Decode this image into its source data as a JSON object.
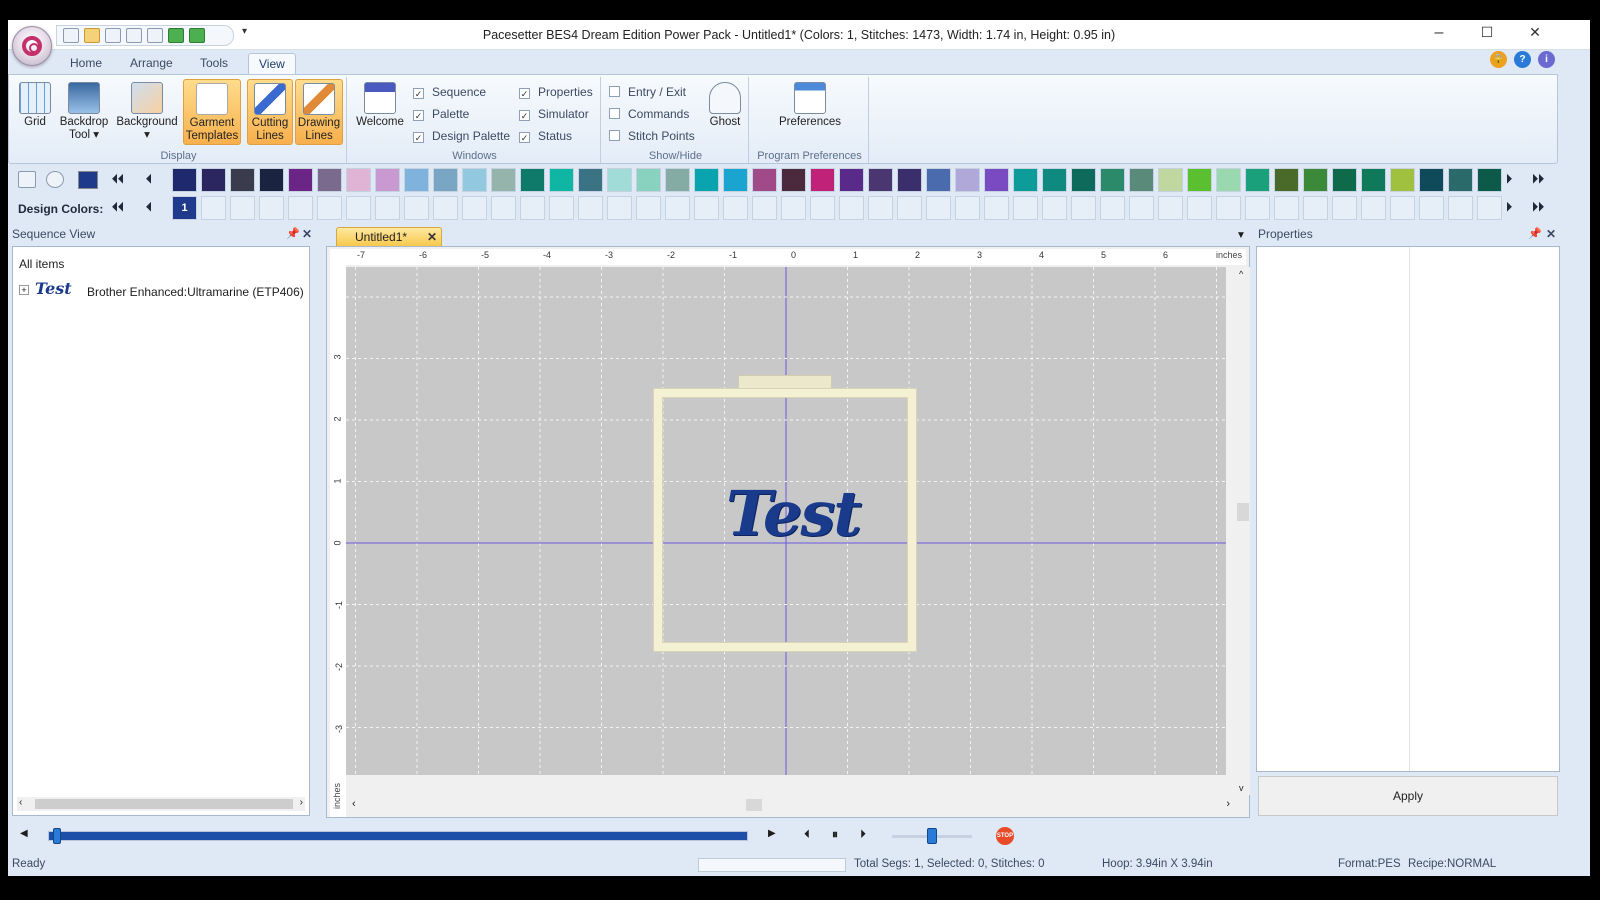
{
  "title": "Pacesetter BES4 Dream Edition Power Pack - Untitled1* (Colors: 1, Stitches: 1473, Width: 1.74 in, Height: 0.95 in)",
  "window_controls": {
    "minimize": "–",
    "maximize": "☐",
    "close": "✕"
  },
  "menu_tabs": [
    "Home",
    "Arrange",
    "Tools",
    "View"
  ],
  "active_tab": "View",
  "ribbon": {
    "display": {
      "label": "Display",
      "buttons": [
        {
          "label1": "Grid",
          "label2": "",
          "icon": "grid-icon"
        },
        {
          "label1": "Backdrop",
          "label2": "Tool ▾",
          "icon": "monitor-icon"
        },
        {
          "label1": "Background",
          "label2": "▾",
          "icon": "background-icon"
        },
        {
          "label1": "Garment",
          "label2": "Templates",
          "icon": "shirt-icon"
        },
        {
          "label1": "Cutting",
          "label2": "Lines",
          "icon": "knife-icon"
        },
        {
          "label1": "Drawing",
          "label2": "Lines",
          "icon": "pen-icon"
        }
      ]
    },
    "windows": {
      "label": "Windows",
      "welcome": "Welcome",
      "col1": [
        {
          "label": "Sequence",
          "checked": true
        },
        {
          "label": "Palette",
          "checked": true
        },
        {
          "label": "Design Palette",
          "checked": true
        }
      ],
      "col2": [
        {
          "label": "Properties",
          "checked": true
        },
        {
          "label": "Simulator",
          "checked": true
        },
        {
          "label": "Status",
          "checked": true
        }
      ]
    },
    "showhide": {
      "label": "Show/Hide",
      "items": [
        {
          "label": "Entry / Exit",
          "checked": false
        },
        {
          "label": "Commands",
          "checked": false
        },
        {
          "label": "Stitch Points",
          "checked": false
        }
      ],
      "ghost": "Ghost"
    },
    "prefs": {
      "label": "Program Preferences",
      "button": "Preferences"
    }
  },
  "palette": {
    "colors": [
      "#1f2a6e",
      "#2b2560",
      "#3b3b4e",
      "#1a2440",
      "#6b2586",
      "#7a6a8e",
      "#e0b4d4",
      "#c99ad2",
      "#7fb2dc",
      "#7aa6c6",
      "#92c8e0",
      "#94b4ac",
      "#0f7a6a",
      "#10b6a4",
      "#3a7484",
      "#a2dcd8",
      "#8ad2c0",
      "#84aca4",
      "#0aa4b0",
      "#1aa4d0",
      "#a04a8a",
      "#4a2a3c",
      "#c0227a",
      "#5a2a8a",
      "#4a3670",
      "#3a2e6c",
      "#4a6cae",
      "#b0a8d8",
      "#7a4ac2",
      "#0e9c9a",
      "#0e8a80",
      "#0e6a5a",
      "#2a8a6a",
      "#5a8a7a",
      "#c0d8a0",
      "#5ac030",
      "#9ad8b0",
      "#1aa07a",
      "#4a6a2a",
      "#3a8a3a",
      "#0e6a4a",
      "#0e7a5a",
      "#a0c040",
      "#0e4a5a",
      "#2a6a6a",
      "#0e5a4a"
    ]
  },
  "design_colors": {
    "label": "Design Colors:",
    "items": [
      "1"
    ],
    "color": "#1f3a8a"
  },
  "sequence_view": {
    "title": "Sequence View",
    "root": "All items",
    "item": "Brother Enhanced:Ultramarine (ETP406)",
    "item_thumb": "Test"
  },
  "document_tab": "Untitled1*",
  "ruler": {
    "units": "inches",
    "x_ticks": [
      "-7",
      "-6",
      "-5",
      "-4",
      "-3",
      "-2",
      "-1",
      "0",
      "1",
      "2",
      "3",
      "4",
      "5",
      "6"
    ],
    "y_ticks": [
      "3",
      "2",
      "1",
      "0",
      "-1",
      "-2",
      "-3"
    ],
    "y_label": "inches"
  },
  "design": {
    "text": "Test",
    "thread_color": "#1a3a8c",
    "hoop_color": "#f3f0d4"
  },
  "properties": {
    "title": "Properties",
    "apply": "Apply"
  },
  "simulator": {
    "progress": 1.0,
    "speed": 0.5
  },
  "status": {
    "ready": "Ready",
    "segs": "Total Segs: 1, Selected: 0, Stitches: 0",
    "hoop": "Hoop: 3.94in X 3.94in",
    "format": "Format:PES",
    "recipe": "Recipe:NORMAL"
  }
}
